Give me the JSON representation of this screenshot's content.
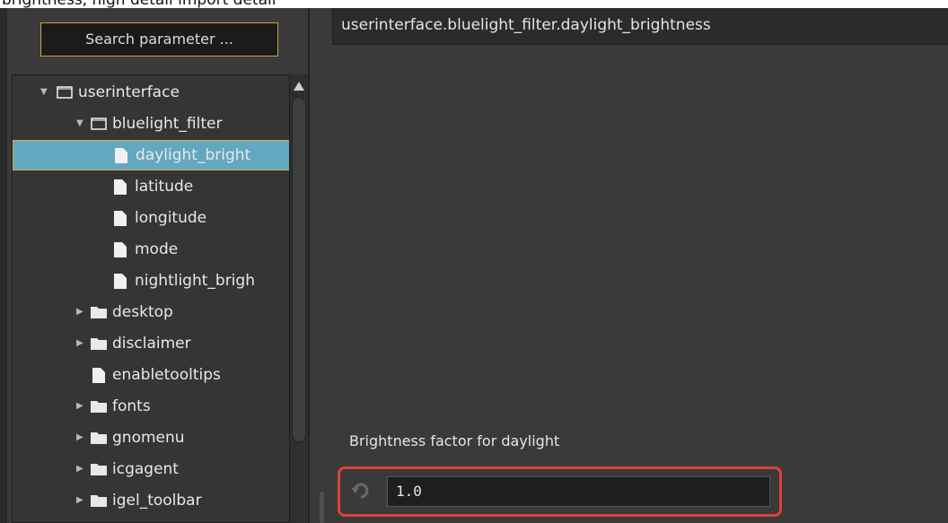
{
  "caption": "brightness, high detail import detail",
  "search": {
    "label": "Search parameter ..."
  },
  "path": "userinterface.bluelight_filter.daylight_brightness",
  "tree": [
    {
      "label": "userinterface",
      "kind": "folder-open",
      "expand": "expanded"
    },
    {
      "label": "bluelight_filter",
      "kind": "folder-open",
      "expand": "expanded"
    },
    {
      "label": "daylight_bright",
      "kind": "file",
      "selected": true
    },
    {
      "label": "latitude",
      "kind": "file"
    },
    {
      "label": "longitude",
      "kind": "file"
    },
    {
      "label": "mode",
      "kind": "file"
    },
    {
      "label": "nightlight_brigh",
      "kind": "file"
    },
    {
      "label": "desktop",
      "kind": "folder",
      "expand": "collapsed"
    },
    {
      "label": "disclaimer",
      "kind": "folder",
      "expand": "collapsed"
    },
    {
      "label": "enabletooltips",
      "kind": "file"
    },
    {
      "label": "fonts",
      "kind": "folder",
      "expand": "collapsed"
    },
    {
      "label": "gnomenu",
      "kind": "folder",
      "expand": "collapsed"
    },
    {
      "label": "icgagent",
      "kind": "folder",
      "expand": "collapsed"
    },
    {
      "label": "igel_toolbar",
      "kind": "folder",
      "expand": "collapsed"
    }
  ],
  "parameter": {
    "description": "Brightness factor for daylight",
    "value": "1.0"
  },
  "colors": {
    "selection": "#63a7c1",
    "selection_border": "#d8b13a",
    "highlight_box": "#e0413c"
  }
}
